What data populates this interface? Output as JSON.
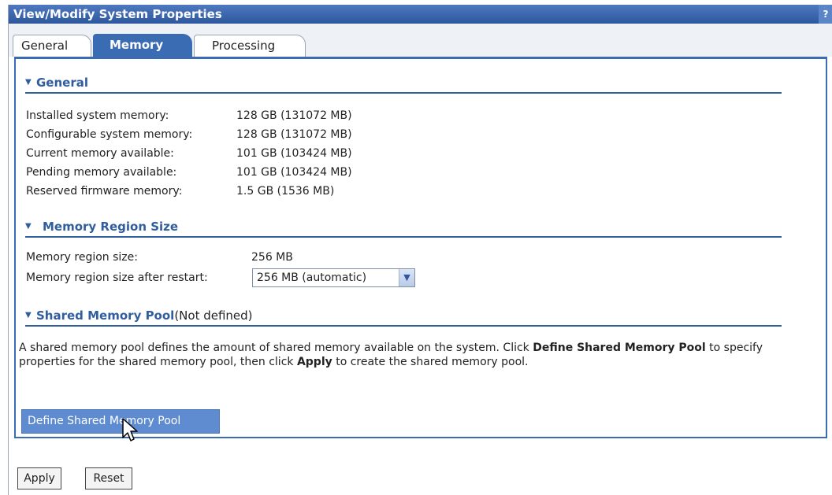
{
  "window": {
    "title": "View/Modify System Properties",
    "help_label": "?"
  },
  "tabs": [
    {
      "label": "General"
    },
    {
      "label": "Memory"
    },
    {
      "label": "Processing"
    }
  ],
  "general_section": {
    "title": "General",
    "rows": [
      {
        "label": "Installed system memory:",
        "value": "128 GB (131072 MB)"
      },
      {
        "label": "Configurable system memory:",
        "value": "128 GB (131072 MB)"
      },
      {
        "label": "Current memory available:",
        "value": "101 GB (103424 MB)"
      },
      {
        "label": "Pending memory available:",
        "value": "101 GB (103424 MB)"
      },
      {
        "label": "Reserved firmware memory:",
        "value": "1.5 GB (1536 MB)"
      }
    ]
  },
  "region_section": {
    "title": "Memory Region Size",
    "size_label": "Memory region size:",
    "size_value": "256 MB",
    "after_restart_label": "Memory region size after restart:",
    "after_restart_value": "256 MB (automatic)"
  },
  "pool_section": {
    "title": "Shared Memory Pool",
    "status": "(Not defined)",
    "description": {
      "part1": "A shared memory pool defines the amount of shared memory available on the system. Click ",
      "bold1": "Define Shared Memory Pool",
      "part2": " to specify properties for the shared memory pool, then click ",
      "bold2": "Apply",
      "part3": " to create the shared memory pool."
    },
    "define_button": "Define Shared Memory Pool"
  },
  "footer": {
    "apply_label": "Apply",
    "reset_label": "Reset"
  },
  "colors": {
    "titlebar": "#2d589e",
    "active_tab": "#3a6cb4",
    "section_heading": "#2f5d9e",
    "define_button": "#5f8cd0"
  }
}
